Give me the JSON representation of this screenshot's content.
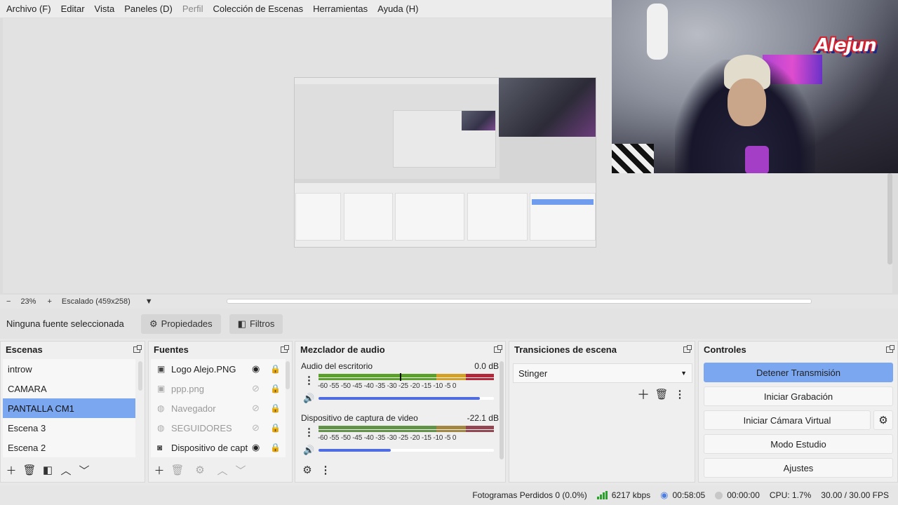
{
  "menu": [
    "Archivo (F)",
    "Editar",
    "Vista",
    "Paneles (D)",
    "Perfil",
    "Colección de Escenas",
    "Herramientas",
    "Ayuda (H)"
  ],
  "logo_text": "Alejun",
  "zoom": {
    "minus": "−",
    "value": "23%",
    "plus": "+",
    "scaling": "Escalado (459x258)"
  },
  "props": {
    "no_source": "Ninguna fuente seleccionada",
    "properties": "Propiedades",
    "filters": "Filtros"
  },
  "scenes": {
    "title": "Escenas",
    "items": [
      "introw",
      "CAMARA",
      "PANTALLA CM1",
      "Escena 3",
      "Escena 2"
    ]
  },
  "sources": {
    "title": "Fuentes",
    "items": [
      {
        "name": "Logo Alejo.PNG",
        "icon": "image-icon",
        "visible": true,
        "locked": false
      },
      {
        "name": "ppp.png",
        "icon": "image-icon",
        "visible": false,
        "locked": false
      },
      {
        "name": "Navegador",
        "icon": "globe-icon",
        "visible": false,
        "locked": true
      },
      {
        "name": "SEGUIDORES",
        "icon": "globe-icon",
        "visible": false,
        "locked": false
      },
      {
        "name": "Dispositivo de captura de video",
        "icon": "camera-icon",
        "visible": true,
        "locked": false
      }
    ]
  },
  "mixer": {
    "title": "Mezclador de audio",
    "channels": [
      {
        "name": "Audio del escritorio",
        "db": "0.0 dB",
        "volume": 0.92,
        "level": 0.46
      },
      {
        "name": "Dispositivo de captura de video",
        "db": "-22.1 dB",
        "volume": 0.41,
        "level": 0.0
      }
    ],
    "scale": "-60 -55 -50 -45 -40 -35 -30 -25 -20 -15 -10 -5 0"
  },
  "transitions": {
    "title": "Transiciones de escena",
    "selected": "Stinger"
  },
  "controls": {
    "title": "Controles",
    "buttons": [
      "Detener Transmisión",
      "Iniciar Grabación",
      "Iniciar Cámara Virtual",
      "Modo Estudio",
      "Ajustes"
    ]
  },
  "status": {
    "dropped": "Fotogramas Perdidos 0 (0.0%)",
    "bitrate": "6217 kbps",
    "stream_time": "00:58:05",
    "rec_time": "00:00:00",
    "cpu": "CPU: 1.7%",
    "fps": "30.00 / 30.00 FPS"
  },
  "colors": {
    "accent": "#7ba7f0",
    "meter_green": "#5ca02c",
    "meter_yellow": "#d2a125",
    "meter_red": "#b0283a",
    "volume_blue": "#4f6de0"
  }
}
